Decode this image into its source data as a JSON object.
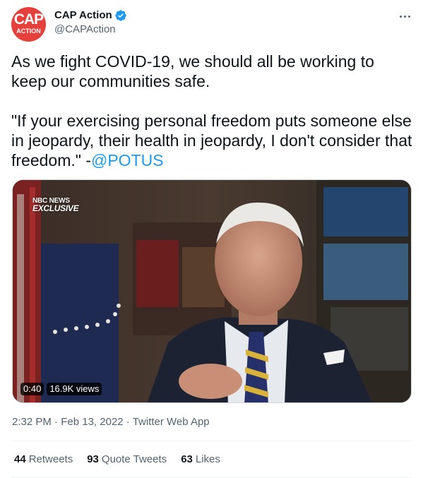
{
  "author": {
    "avatar_text_top": "CAP",
    "avatar_text_bottom": "ACTION",
    "display_name": "CAP Action",
    "handle": "@CAPAction",
    "verified": true
  },
  "tweet": {
    "paragraph1": "As we fight COVID-19, we should all be working to keep our communities safe.",
    "paragraph2_text": "\"If your exercising personal freedom puts someone else in jeopardy, their health in jeopardy, I don't consider that freedom.\" -",
    "mention": "@POTUS"
  },
  "video": {
    "overlay_line1": "NBC NEWS",
    "overlay_line2": "EXCLUSIVE",
    "duration": "0:40",
    "views": "16.9K views"
  },
  "meta": {
    "time": "2:32 PM",
    "date": "Feb 13, 2022",
    "source": "Twitter Web App",
    "separator": "·"
  },
  "stats": [
    {
      "count": "44",
      "label": "Retweets"
    },
    {
      "count": "93",
      "label": "Quote Tweets"
    },
    {
      "count": "63",
      "label": "Likes"
    }
  ],
  "colors": {
    "brand": "#e5403b",
    "link": "#1d9bf0",
    "secondary_text": "#536471"
  },
  "icons": {
    "verified": "verified-badge-icon",
    "more": "more-options-icon"
  }
}
